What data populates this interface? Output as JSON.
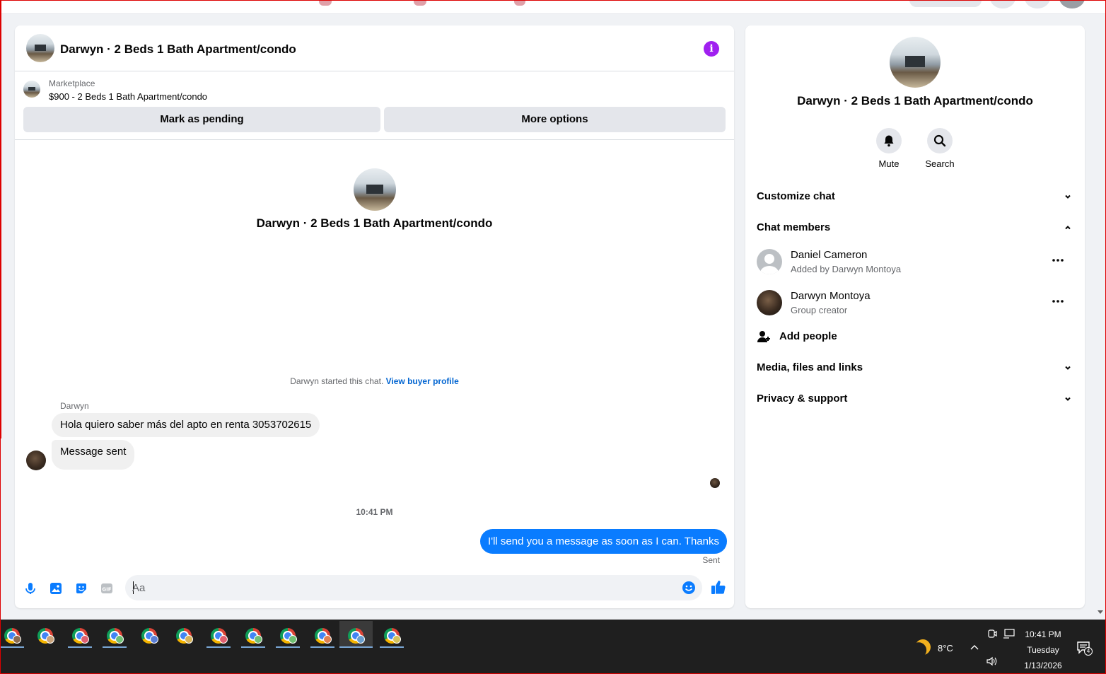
{
  "chat": {
    "title": "Darwyn · 2 Beds 1 Bath Apartment/condo",
    "marketplace_label": "Marketplace",
    "listing": "$900 - 2 Beds 1 Bath Apartment/condo",
    "mark_pending_label": "Mark as pending",
    "more_options_label": "More options",
    "center_title": "Darwyn · 2 Beds 1 Bath Apartment/condo",
    "started_text": "Darwyn started this chat.",
    "view_buyer_label": "View buyer profile",
    "messages": [
      {
        "sender": "Darwyn",
        "text": "Hola quiero saber más del apto en renta 3053702615"
      },
      {
        "text": "Message sent"
      }
    ],
    "timestamp": "10:41 PM",
    "outgoing_text": "I'll send you a message as soon as I can. Thanks",
    "sent_status": "Sent",
    "composer_placeholder": "Aa"
  },
  "side": {
    "title": "Darwyn · 2 Beds 1 Bath Apartment/condo",
    "actions": [
      {
        "label": "Mute",
        "icon": "bell-icon"
      },
      {
        "label": "Search",
        "icon": "search-icon"
      }
    ],
    "sections": {
      "customize": "Customize chat",
      "members": "Chat members",
      "media": "Media, files and links",
      "privacy": "Privacy & support"
    },
    "members": [
      {
        "name": "Daniel Cameron",
        "sub": "Added by Darwyn Montoya"
      },
      {
        "name": "Darwyn Montoya",
        "sub": "Group creator"
      }
    ],
    "add_people": "Add people"
  },
  "taskbar": {
    "temperature": "8°C",
    "time": "10:41 PM",
    "day": "Tuesday",
    "date": "1/13/2026",
    "notification_count": "4"
  },
  "colors": {
    "accent": "#0a7cff",
    "info": "#a020f0",
    "bubble_in": "#f0f0f0",
    "taskbar": "#1f1f1f"
  }
}
